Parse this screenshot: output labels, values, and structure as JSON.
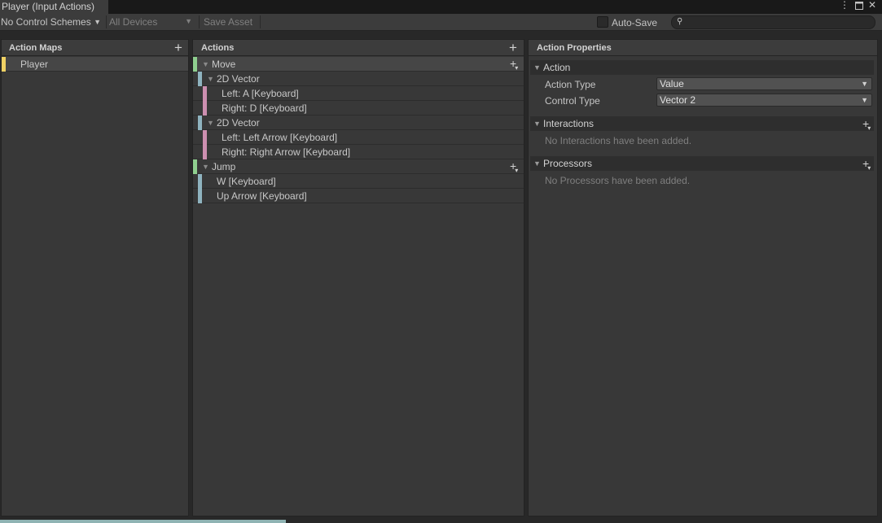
{
  "window": {
    "tab_title": "Player (Input Actions)",
    "menu_icon": "vertical-dots-icon",
    "maximize_icon": "maximize-icon",
    "close_icon": "close-icon"
  },
  "toolbar": {
    "control_schemes": "No Control Schemes",
    "devices": "All Devices",
    "save_asset": "Save Asset",
    "auto_save_label": "Auto-Save",
    "auto_save_checked": false,
    "search_value": "",
    "search_icon": "search-icon"
  },
  "action_maps": {
    "header": "Action Maps",
    "add_icon": "plus-icon",
    "items": [
      {
        "label": "Player",
        "selected": true,
        "color": "#f0d264"
      }
    ]
  },
  "actions": {
    "header": "Actions",
    "add_icon": "plus-icon",
    "rows": [
      {
        "label": "Move",
        "kind": "action",
        "color": "#8fcf8f"
      },
      {
        "label": "2D Vector",
        "kind": "composite",
        "color": "#8fb3bf"
      },
      {
        "label": "Left: A [Keyboard]",
        "kind": "part",
        "color": "#cc8fb0"
      },
      {
        "label": "Right: D [Keyboard]",
        "kind": "part",
        "color": "#cc8fb0"
      },
      {
        "label": "2D Vector",
        "kind": "composite",
        "color": "#8fb3bf"
      },
      {
        "label": "Left: Left Arrow [Keyboard]",
        "kind": "part",
        "color": "#cc8fb0"
      },
      {
        "label": "Right: Right Arrow [Keyboard]",
        "kind": "part",
        "color": "#cc8fb0"
      },
      {
        "label": "Jump",
        "kind": "action",
        "color": "#8fcf8f"
      },
      {
        "label": "W [Keyboard]",
        "kind": "binding",
        "color": "#8fb3bf"
      },
      {
        "label": "Up Arrow [Keyboard]",
        "kind": "binding",
        "color": "#8fb3bf"
      }
    ]
  },
  "properties": {
    "header": "Action Properties",
    "action_section": "Action",
    "action_type_label": "Action Type",
    "action_type_value": "Value",
    "control_type_label": "Control Type",
    "control_type_value": "Vector 2",
    "interactions_section": "Interactions",
    "interactions_empty": "No Interactions have been added.",
    "processors_section": "Processors",
    "processors_empty": "No Processors have been added."
  }
}
